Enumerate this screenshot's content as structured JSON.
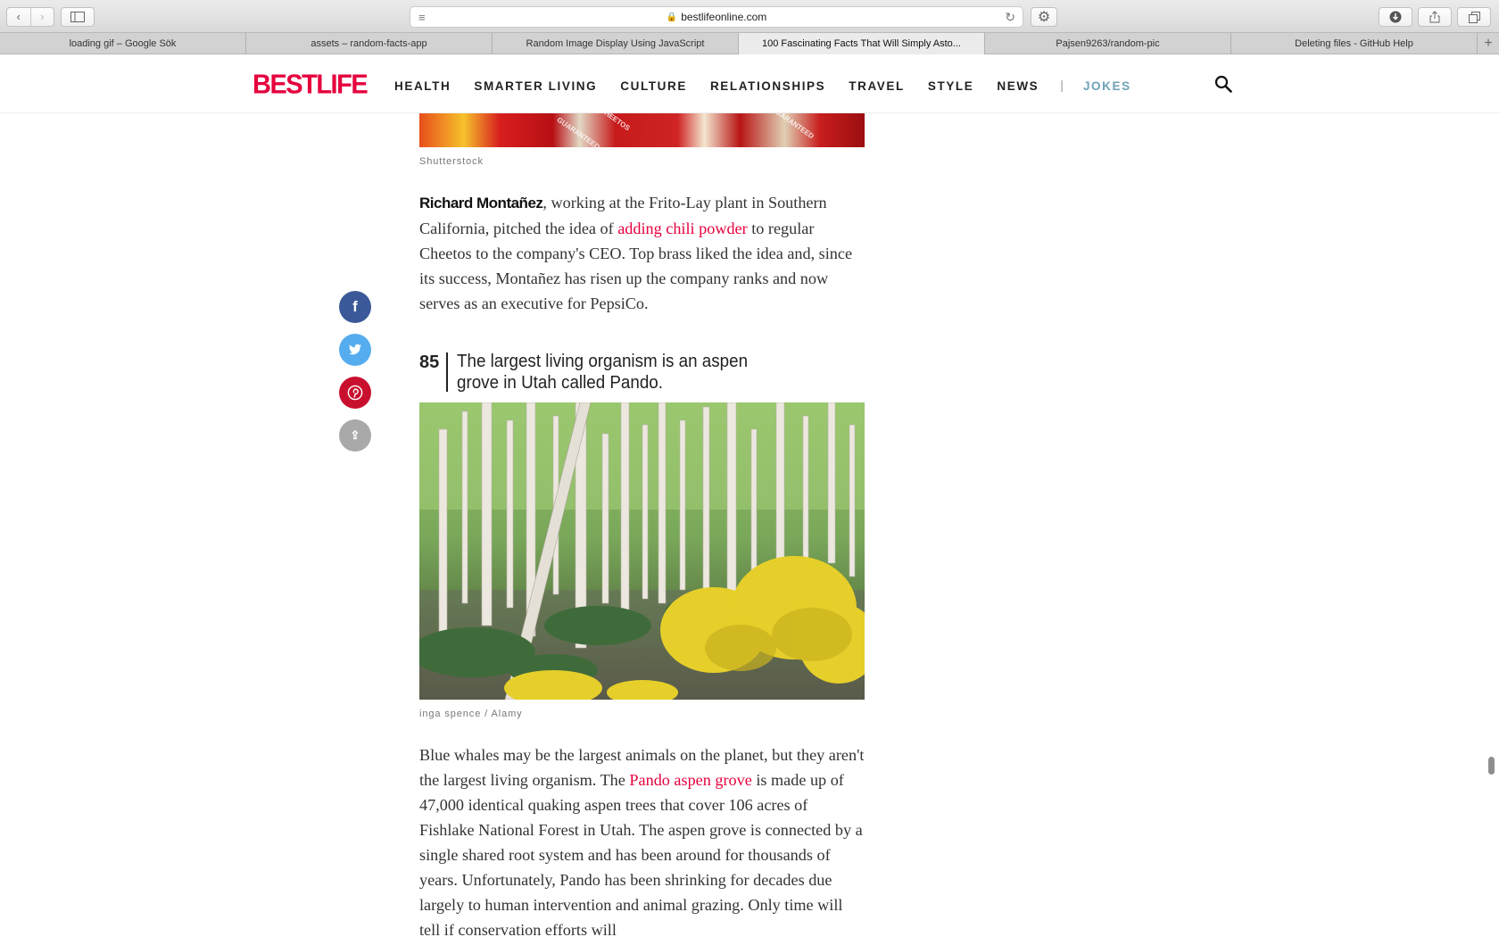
{
  "browser": {
    "url": "bestlifeonline.com",
    "tabs": [
      {
        "title": "loading gif – Google Sök",
        "active": false
      },
      {
        "title": "assets – random-facts-app",
        "active": false
      },
      {
        "title": "Random Image Display Using JavaScript",
        "active": false
      },
      {
        "title": "100 Fascinating Facts That Will Simply Asto...",
        "active": true
      },
      {
        "title": "Pajsen9263/random-pic",
        "active": false
      },
      {
        "title": "Deleting files - GitHub Help",
        "active": false
      }
    ]
  },
  "site": {
    "logo": "BESTLIFE",
    "nav": [
      "HEALTH",
      "SMARTER LIVING",
      "CULTURE",
      "RELATIONSHIPS",
      "TRAVEL",
      "STYLE",
      "NEWS"
    ],
    "nav_sep": "|",
    "nav_highlight": "JOKES",
    "accent": "#e5003d",
    "jokes_color": "#6fa2b8"
  },
  "article": {
    "top_photo_credit": "Shutterstock",
    "para1": {
      "name": "Richard Montañez",
      "t1": ", working at the Frito-Lay plant in Southern California, pitched the idea of ",
      "link": "adding chili powder",
      "t2": " to regular Cheetos to the company's CEO. Top brass liked the idea and, since its success, Montañez has risen up the company ranks and now serves as an executive for PepsiCo."
    },
    "fact": {
      "number": "85",
      "title": "The largest living organism is an aspen grove in Utah called Pando."
    },
    "photo_credit": "inga spence / Alamy",
    "para2": {
      "t1": "Blue whales may be the largest animals on the planet, but they aren't the largest living organism. The ",
      "link": "Pando aspen grove",
      "t2": " is made up of 47,000 identical quaking aspen trees that cover 106 acres of Fishlake National Forest in Utah. The aspen grove is connected by a single shared root system and has been around for thousands of years. Unfortunately, Pando has been shrinking for decades due largely to human intervention and animal grazing. Only time will tell if conservation efforts will"
    }
  },
  "share": {
    "facebook": "f",
    "twitter": "t",
    "pinterest": "p",
    "more": "⇪"
  }
}
